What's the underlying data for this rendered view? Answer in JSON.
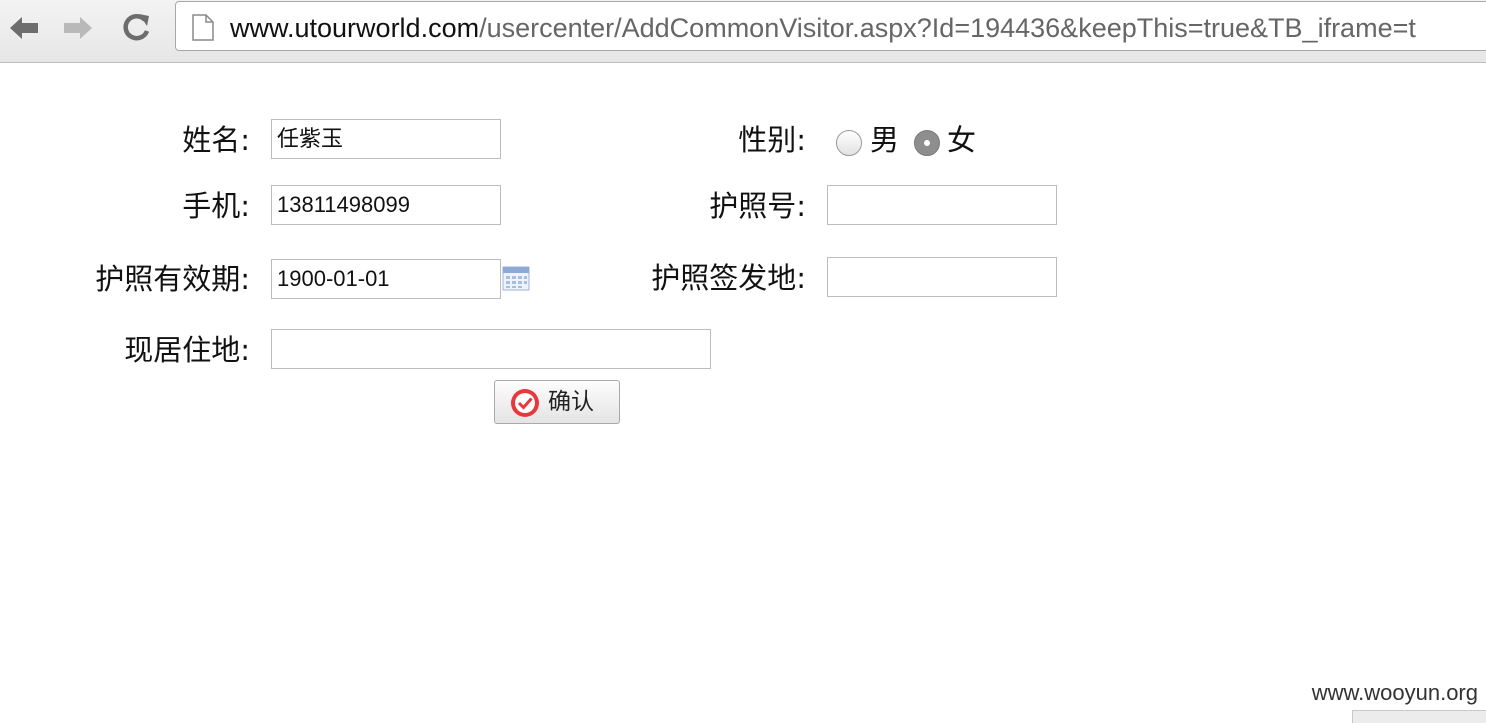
{
  "browser": {
    "url_host": "www.utourworld.com",
    "url_path": "/usercenter/AddCommonVisitor.aspx?Id=194436&keepThis=true&TB_iframe=t"
  },
  "form": {
    "name_label": "姓名:",
    "name_value": "任紫玉",
    "gender_label": "性别:",
    "gender_options": [
      "男",
      "女"
    ],
    "gender_selected": "女",
    "mobile_label": "手机:",
    "mobile_value": "13811498099",
    "passport_label": "护照号:",
    "passport_value": "",
    "passport_expiry_label": "护照有效期:",
    "passport_expiry_value": "1900-01-01",
    "passport_issue_place_label": "护照签发地:",
    "passport_issue_place_value": "",
    "address_label": "现居住地:",
    "address_value": "",
    "confirm_label": "确认"
  },
  "watermark": "www.wooyun.org",
  "colors": {
    "confirm_icon": "#e8373d",
    "radio_selected": "#8e8e8e"
  }
}
